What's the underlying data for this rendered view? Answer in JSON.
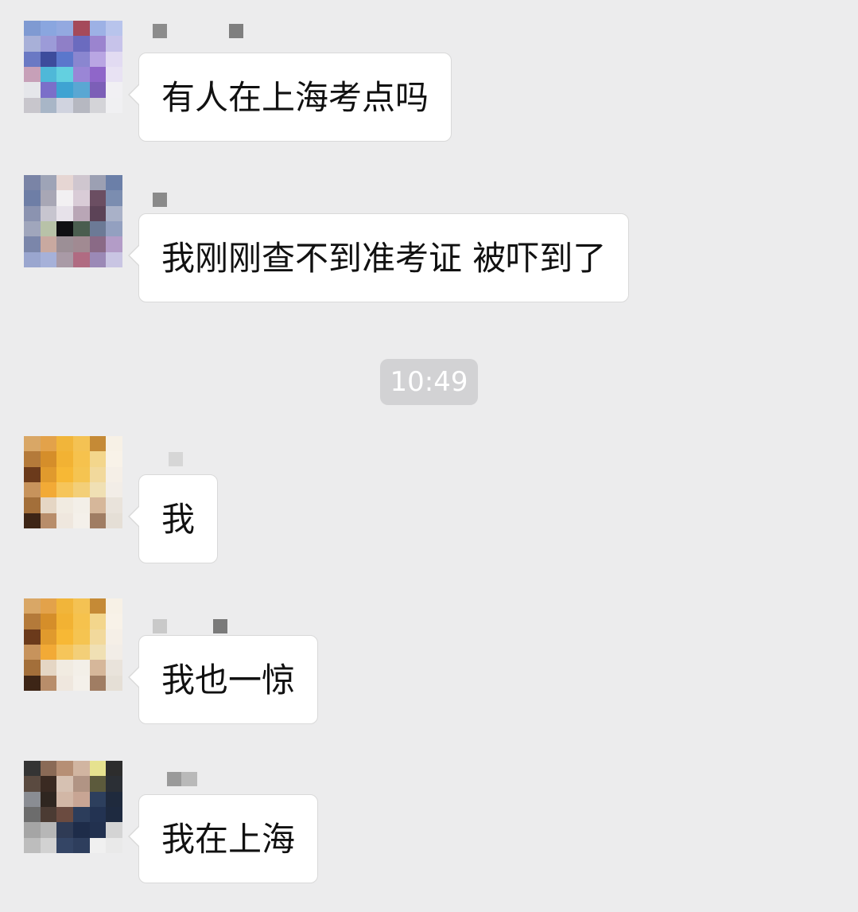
{
  "messages": [
    {
      "text": "有人在上海考点吗"
    },
    {
      "text": "我刚刚查不到准考证 被吓到了"
    },
    {
      "text": "我"
    },
    {
      "text": "我也一惊"
    },
    {
      "text": "我在上海"
    }
  ],
  "timestamp": "10:49",
  "colors": {
    "background": "#ececed",
    "bubble": "#ffffff",
    "bubble_border": "#d9d9d9",
    "timestamp_bg": "#d2d2d4"
  },
  "icons": [
    "avatar",
    "nickname-redacted"
  ]
}
